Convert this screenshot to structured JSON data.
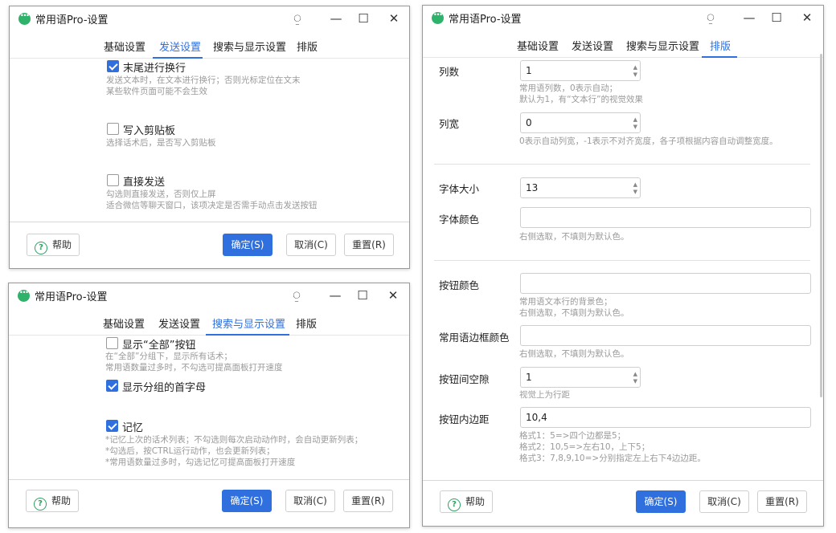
{
  "app": {
    "title": "常用语Pro-设置"
  },
  "tabs": [
    "基础设置",
    "发送设置",
    "搜索与显示设置",
    "排版"
  ],
  "footer": {
    "help": "帮助",
    "ok": "确定(S)",
    "cancel": "取消(C)",
    "reset": "重置(R)"
  },
  "send_window": {
    "options": [
      {
        "label": "末尾进行换行",
        "checked": true,
        "hints": [
          "发送文本时，在文本进行换行；否则光标定位在文末",
          "某些软件页面可能不会生效"
        ]
      },
      {
        "label": "写入剪贴板",
        "checked": false,
        "hints": [
          "选择话术后，是否写入剪贴板"
        ]
      },
      {
        "label": "直接发送",
        "checked": false,
        "hints": [
          "勾选则直接发送，否则仅上屏",
          "适合微信等聊天窗口，该项决定是否需手动点击发送按钮"
        ]
      }
    ]
  },
  "search_window": {
    "options": [
      {
        "label": "显示“全部”按钮",
        "checked": false,
        "hints": [
          "在“全部”分组下，显示所有话术；",
          "常用语数量过多时，不勾选可提高面板打开速度"
        ]
      },
      {
        "label": "显示分组的首字母",
        "checked": true,
        "hints": []
      },
      {
        "label": "记忆",
        "checked": true,
        "hints": [
          "*记忆上次的话术列表；不勾选则每次启动动作时，会自动更新列表；",
          "*勾选后，按CTRL运行动作，也会更新列表；",
          "*常用语数量过多时，勾选记忆可提高面板打开速度"
        ]
      }
    ]
  },
  "layout_window": {
    "columns": {
      "label": "列数",
      "value": "1",
      "hints": [
        "常用语列数，0表示自动；",
        "默认为1，有“文本行”的视觉效果"
      ]
    },
    "col_width": {
      "label": "列宽",
      "value": "0",
      "hints": [
        "0表示自动列宽，-1表示不对齐宽度，各子项根据内容自动调整宽度。"
      ]
    },
    "font_size": {
      "label": "字体大小",
      "value": "13"
    },
    "font_color": {
      "label": "字体颜色",
      "value": "",
      "hints": [
        "右侧选取，不填则为默认色。"
      ]
    },
    "btn_color": {
      "label": "按钮颜色",
      "value": "",
      "hints": [
        "常用语文本行的背景色；",
        "右侧选取，不填则为默认色。"
      ]
    },
    "border_color": {
      "label": "常用语边框颜色",
      "value": "",
      "hints": [
        "右侧选取，不填则为默认色。"
      ]
    },
    "btn_gap": {
      "label": "按钮间空隙",
      "value": "1",
      "hints": [
        "视觉上为行距"
      ]
    },
    "btn_padding": {
      "label": "按钮内边距",
      "value": "10,4",
      "hints": [
        "格式1：5=>四个边都是5；",
        "格式2：10,5=>左右10，上下5；",
        "格式3：7,8,9,10=>分别指定左上右下4边边距。"
      ]
    }
  }
}
